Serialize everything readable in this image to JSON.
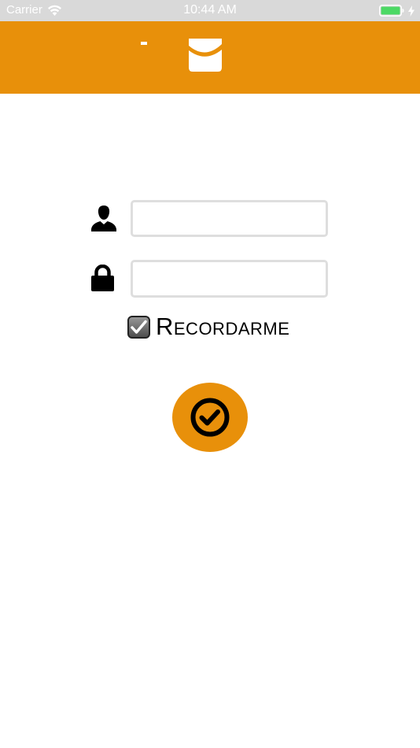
{
  "status_bar": {
    "carrier": "Carrier",
    "time": "10:44 AM",
    "battery_color": "#4cd964"
  },
  "header": {
    "background_color": "#e8900a",
    "logo_icon": "mail-envelope-icon"
  },
  "login_form": {
    "username": {
      "icon": "user-icon",
      "value": ""
    },
    "password": {
      "icon": "lock-icon",
      "value": ""
    },
    "remember_me": {
      "label": "Recordarme",
      "checked": true
    },
    "submit": {
      "icon": "check-circle-icon",
      "color": "#e8900a"
    }
  }
}
